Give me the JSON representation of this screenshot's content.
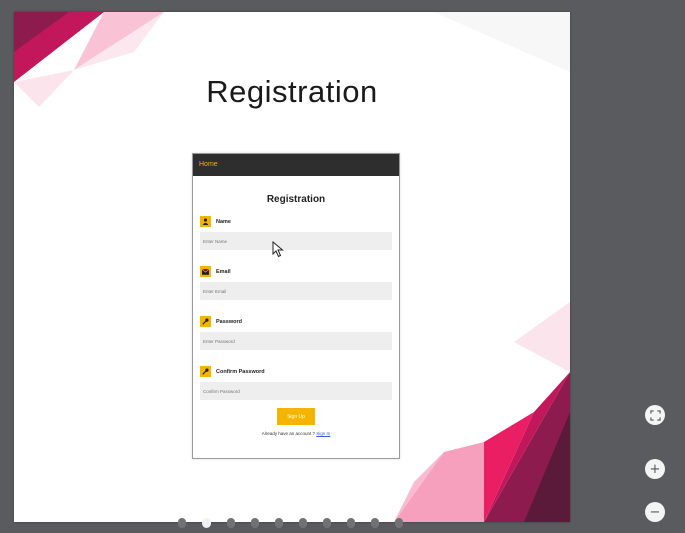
{
  "slide": {
    "title": "Registration"
  },
  "form": {
    "nav_label": "Home",
    "heading": "Registration",
    "fields": [
      {
        "label": "Name",
        "placeholder": "Enter Name",
        "icon": "user-icon"
      },
      {
        "label": "Email",
        "placeholder": "Enter Email",
        "icon": "envelope-icon"
      },
      {
        "label": "Password",
        "placeholder": "Enter Password",
        "icon": "key-icon"
      },
      {
        "label": "Confirm Password",
        "placeholder": "Confirm Password",
        "icon": "key-icon"
      }
    ],
    "submit_label": "Sign Up",
    "signin_prompt": "Already have an account ?",
    "signin_link": "Sign In"
  },
  "viewer": {
    "slide_count": 10,
    "active_slide_index": 1,
    "controls": {
      "fit_icon": "fit-screen-icon",
      "zoom_in_icon": "zoom-in-icon",
      "zoom_out_icon": "zoom-out-icon"
    }
  },
  "colors": {
    "accent": "#f5b400",
    "nav_bg": "#2e2e2e",
    "viewer_bg": "#5a5b5e",
    "decor_magenta": "#c2185b",
    "decor_pink": "#f48fb1"
  }
}
